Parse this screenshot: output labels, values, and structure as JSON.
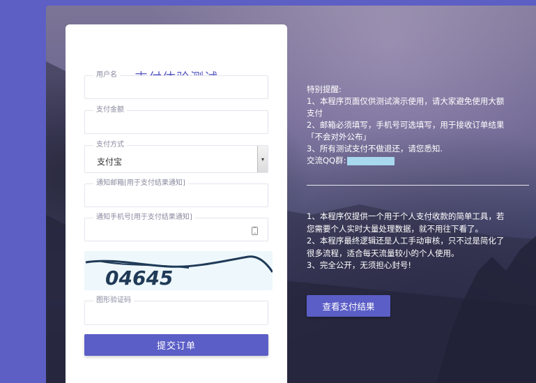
{
  "form": {
    "title": "支付体验测试",
    "username": {
      "label": "用户名",
      "value": ""
    },
    "amount": {
      "label": "支付金额",
      "value": ""
    },
    "method": {
      "label": "支付方式",
      "value": "支付宝"
    },
    "email": {
      "label": "通知邮箱[用于支付结果通知]",
      "value": ""
    },
    "phone": {
      "label": "通知手机号[用于支付结果通知]",
      "value": ""
    },
    "captcha_text": "04645",
    "captcha_input": {
      "label": "图形验证码",
      "value": ""
    },
    "submit_label": "提交订单"
  },
  "notice": {
    "heading": "特别提醒:",
    "lines": [
      "1、本程序页面仅供测试演示使用，请大家避免使用大额",
      "支付",
      "2、邮箱必须填写，手机号可选填写，用于接收订单结果",
      "「不会对外公布」",
      "3、所有测试支付不做退还，请您悉知."
    ],
    "qq_label": "交流QQ群:"
  },
  "intro": {
    "lines": [
      "1、本程序仅提供一个用于个人支付收款的简单工具，若",
      "您需要个人实时大量处理数据，就不用往下看了。",
      "2、本程序最终逻辑还是人工手动审核，只不过是简化了",
      "很多流程，适合每天流量较小的个人使用。",
      "3、完全公开，无须担心封号!"
    ]
  },
  "result_button_label": "查看支付结果",
  "colors": {
    "accent": "#5b5ec6",
    "page_bg": "#5d5fc4",
    "qq_mask": "#a7d8ee"
  }
}
